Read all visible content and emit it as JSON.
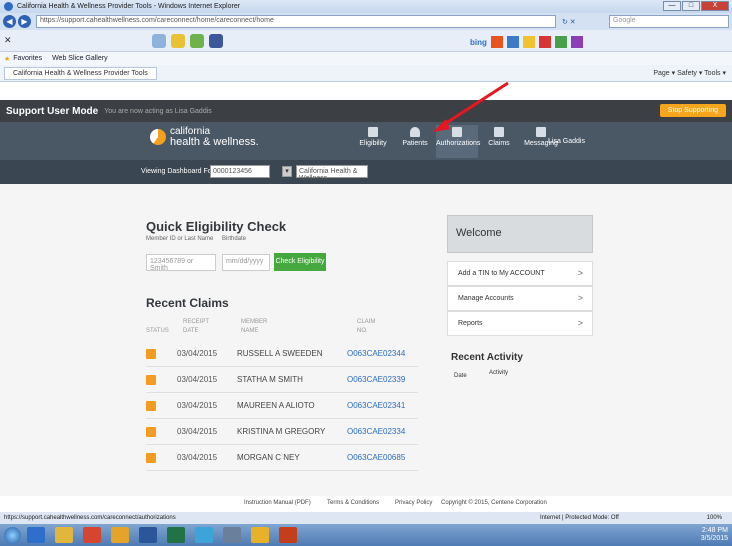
{
  "browser": {
    "title": "California Health & Wellness Provider Tools - Windows Internet Explorer",
    "url": "https://support.cahealthwellness.com/careconnect/home/careconnect/home",
    "search_placeholder": "Google",
    "bing": "bing",
    "favorites_label": "Favorites",
    "web_slice": "Web Slice Gallery",
    "tab_label": "California Health & Wellness Provider Tools",
    "command_bar": "Page ▾  Safety ▾  Tools ▾",
    "status_url": "https://support.cahealthwellness.com/careconnect/authorizations",
    "status_zone": "Internet | Protected Mode: Off",
    "zoom": "100%",
    "minimize": "—",
    "maximize": "□",
    "close": "X"
  },
  "support_bar": {
    "mode": "Support User Mode",
    "sub": "You are now acting as Lisa Gaddis",
    "stop_button": "Stop Supporting"
  },
  "header": {
    "logo_line1": "california",
    "logo_line2": "health & wellness.",
    "nav": [
      "Eligibility",
      "Patients",
      "Authorizations",
      "Claims",
      "Messaging"
    ],
    "active_nav": "Authorizations",
    "user": "Lisa Gaddis"
  },
  "viewing": {
    "label": "Viewing Dashboard For :",
    "tin": "0000123456",
    "plan": "California Health & Wellness"
  },
  "qec": {
    "title": "Quick Eligibility Check",
    "member_label": "Member ID or Last Name",
    "birthdate_label": "Birthdate",
    "member_placeholder": "123456789 or Smith",
    "birthdate_placeholder": "mm/dd/yyyy",
    "button": "Check Eligibility"
  },
  "recent_claims": {
    "title": "Recent Claims",
    "headers": {
      "status": "STATUS",
      "receipt1": "RECEIPT",
      "receipt2": "DATE",
      "member1": "MEMBER",
      "member2": "NAME",
      "claim1": "CLAIM",
      "claim2": "NO."
    },
    "rows": [
      {
        "date": "03/04/2015",
        "name": "RUSSELL A SWEEDEN",
        "claim": "O063CAE02344"
      },
      {
        "date": "03/04/2015",
        "name": "STATHA M SMITH",
        "claim": "O063CAE02339"
      },
      {
        "date": "03/04/2015",
        "name": "MAUREEN A ALIOTO",
        "claim": "O063CAE02341"
      },
      {
        "date": "03/04/2015",
        "name": "KRISTINA M GREGORY",
        "claim": "O063CAE02334"
      },
      {
        "date": "03/04/2015",
        "name": "MORGAN C NEY",
        "claim": "O063CAE00685"
      }
    ]
  },
  "welcome": {
    "title": "Welcome",
    "items": [
      "Add a TIN to My ACCOUNT",
      "Manage Accounts",
      "Reports"
    ],
    "recent_activity": "Recent Activity",
    "date_col": "Date",
    "activity_col": "Activity"
  },
  "footer": {
    "manual": "Instruction Manual (PDF)",
    "terms": "Terms & Conditions",
    "privacy": "Privacy Policy",
    "copyright": "Copyright © 2015, Centene Corporation"
  },
  "taskbar": {
    "time": "2:48 PM",
    "date": "3/5/2015"
  },
  "colors": {
    "header": "#4a5866",
    "accent_orange": "#f39b23",
    "button_green": "#44a83e",
    "link_blue": "#2c6dbd",
    "arrow": "#e8171f"
  }
}
